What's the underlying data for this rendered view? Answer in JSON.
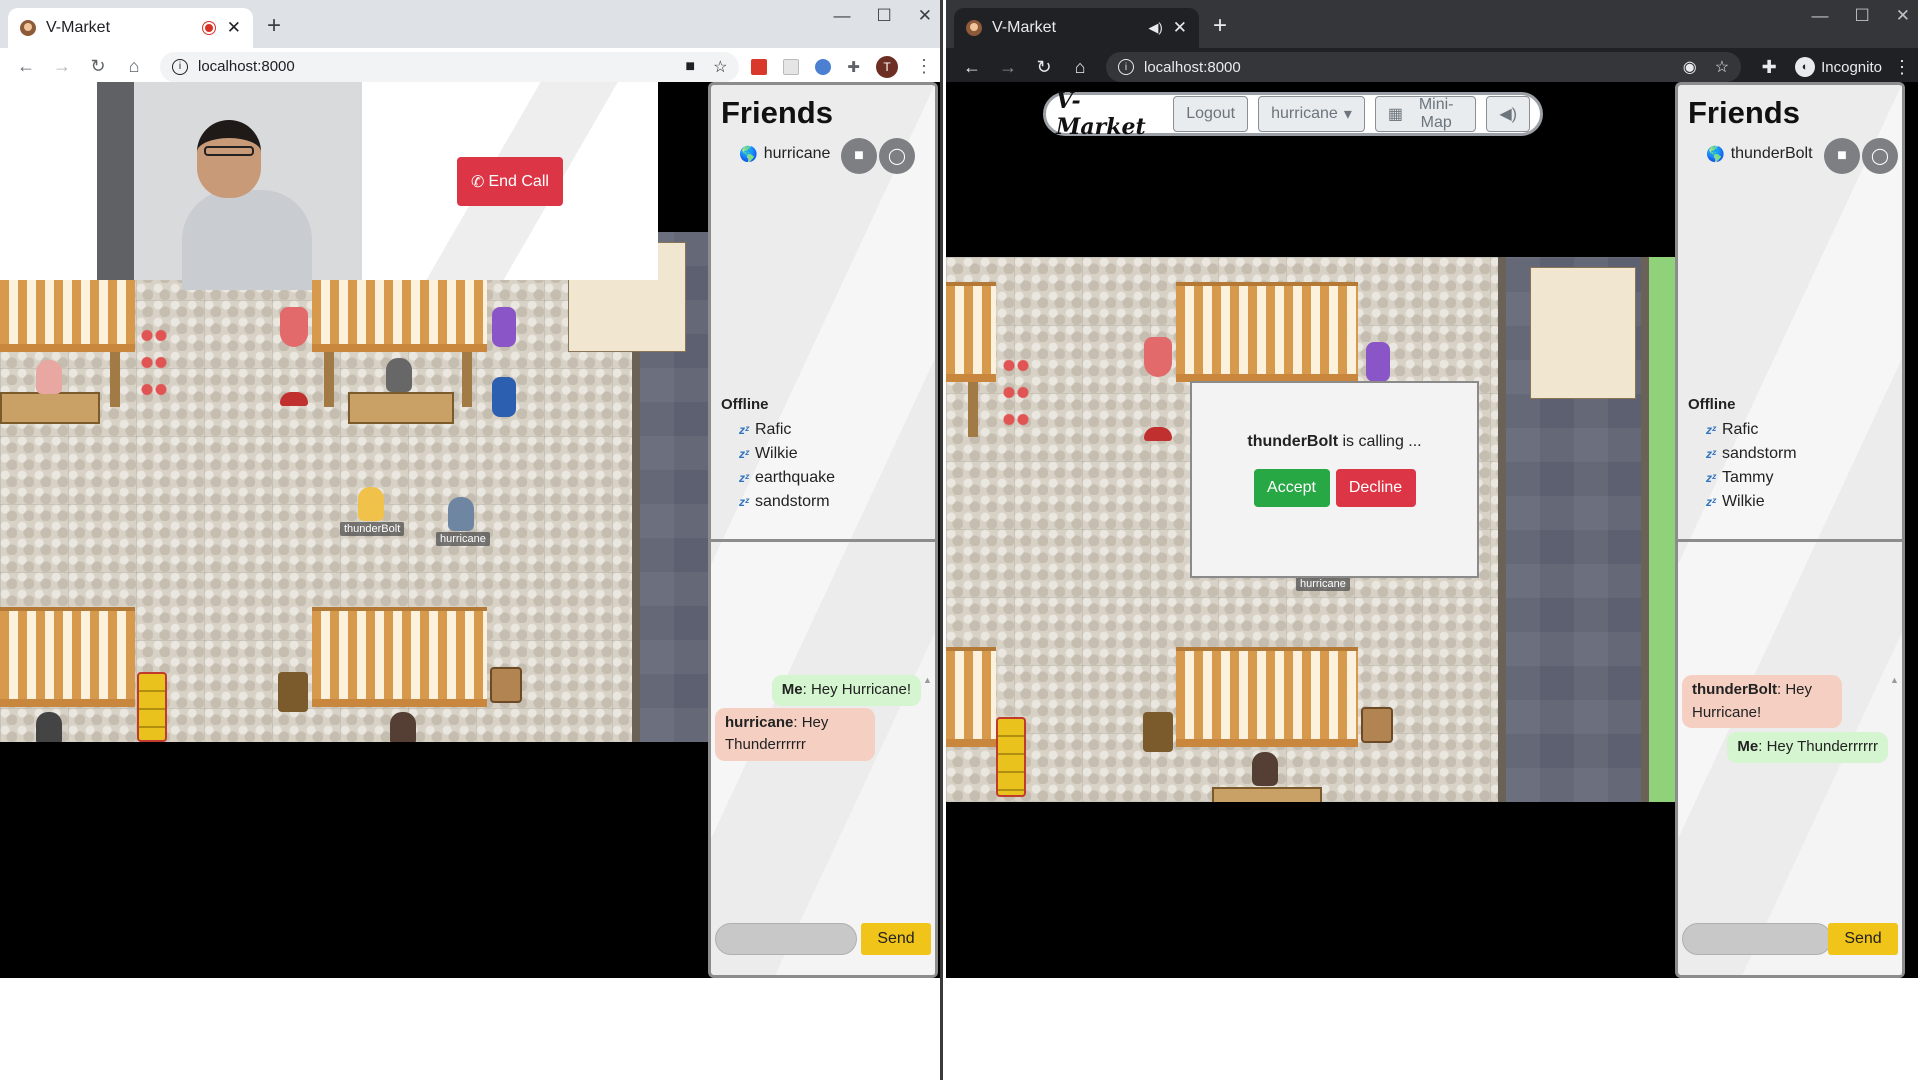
{
  "left": {
    "tab_title": "V-Market",
    "url": "localhost:8000",
    "profile_initial": "T",
    "call": {
      "end_label": "End Call"
    },
    "friends": {
      "heading": "Friends",
      "online": [
        "hurricane"
      ],
      "offline_label": "Offline",
      "offline": [
        "Rafic",
        "Wilkie",
        "earthquake",
        "sandstorm"
      ]
    },
    "chat": {
      "messages": [
        {
          "sender": "Me",
          "text": "Hey Hurricane!"
        },
        {
          "sender": "hurricane",
          "text": "Hey Thunderrrrrr"
        }
      ],
      "send_label": "Send"
    },
    "map_labels": [
      "thunderBolt",
      "hurricane"
    ]
  },
  "right": {
    "tab_title": "V-Market",
    "url": "localhost:8000",
    "incognito_label": "Incognito",
    "navbar": {
      "brand": "V-Market",
      "logout": "Logout",
      "user": "hurricane",
      "minimap": "Mini-Map"
    },
    "modal": {
      "caller": "thunderBolt",
      "text": " is calling ...",
      "accept": "Accept",
      "decline": "Decline"
    },
    "friends": {
      "heading": "Friends",
      "online": [
        "thunderBolt"
      ],
      "offline_label": "Offline",
      "offline": [
        "Rafic",
        "sandstorm",
        "Tammy",
        "Wilkie"
      ]
    },
    "chat": {
      "messages": [
        {
          "sender": "thunderBolt",
          "text": "Hey Hurricane!"
        },
        {
          "sender": "Me",
          "text": "Hey Thunderrrrrr"
        }
      ],
      "send_label": "Send"
    },
    "map_labels": [
      "hurricane"
    ]
  },
  "colors": {
    "danger": "#dc3545",
    "success": "#28a745",
    "send": "#f0c419"
  }
}
